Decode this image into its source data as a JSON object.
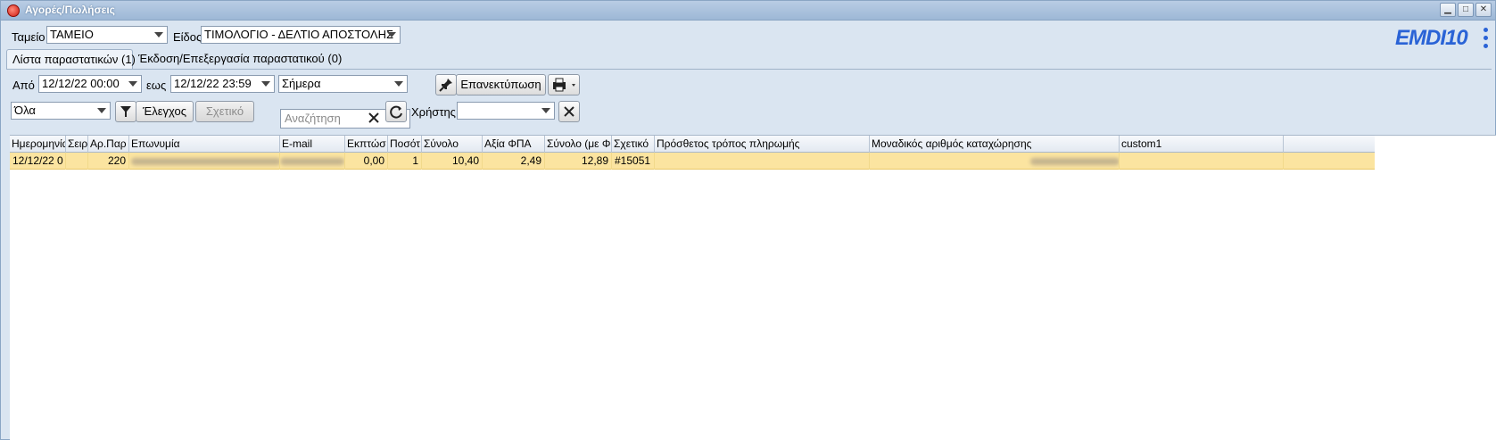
{
  "window": {
    "title": "Αγορές/Πωλήσεις"
  },
  "filters": {
    "tameio_label": "Ταμείο",
    "tameio_value": "ΤΑΜΕΙΟ",
    "eidos_label": "Είδος",
    "eidos_value": "ΤΙΜΟΛΟΓΙΟ - ΔΕΛΤΙΟ ΑΠΟΣΤΟΛΗΣ"
  },
  "logo": {
    "text": "EMDI10",
    "color": "#2a63d6"
  },
  "tabs": [
    {
      "label": "Λίστα παραστατικών (1)"
    },
    {
      "label": "Έκδοση/Επεξεργασία παραστατικού (0)"
    }
  ],
  "date_range": {
    "from_label": "Από",
    "from_value": "12/12/22 00:00",
    "to_label": "εως",
    "to_value": "12/12/22 23:59",
    "period_value": "Σήμερα"
  },
  "toolbar": {
    "reprint_label": "Επανεκτύπωση",
    "status_value": "Όλα",
    "check_label": "Έλεγχος",
    "related_label": "Σχετικό",
    "search_placeholder": "Αναζήτηση",
    "user_label": "Χρήστης",
    "user_value": ""
  },
  "grid": {
    "columns": [
      "Ημερομηνία",
      "Σειρ",
      "Αρ.Παρ",
      "Επωνυμία",
      "E-mail",
      "Εκπτώσ",
      "Ποσότ",
      "Σύνολο",
      "Αξία ΦΠΑ",
      "Σύνολο (με Φ",
      "Σχετικό",
      "Πρόσθετος τρόπος πληρωμής",
      "Μοναδικός αριθμός καταχώρησης",
      "custom1"
    ],
    "rows": [
      {
        "date": "12/12/22 0",
        "series": "",
        "number": "220",
        "name": "",
        "email": "",
        "discount": "0,00",
        "quantity": "1",
        "total": "10,40",
        "vat": "2,49",
        "total_with_vat": "12,89",
        "related": "#15051",
        "extra_payment": "",
        "unique_id": "",
        "custom1": ""
      }
    ]
  },
  "colors": {
    "selected_row": "#fbe4a0",
    "window_bg": "#dae5f1"
  }
}
